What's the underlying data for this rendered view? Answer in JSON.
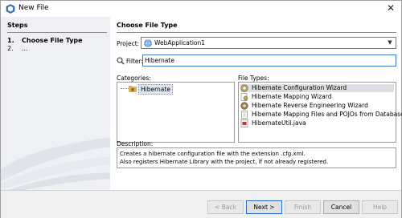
{
  "window": {
    "title": "New File",
    "close_glyph": "✕"
  },
  "steps": {
    "title": "Steps",
    "items": [
      {
        "num": "1.",
        "label": "Choose File Type"
      },
      {
        "num": "2.",
        "label": "..."
      }
    ]
  },
  "main": {
    "title": "Choose File Type",
    "project": {
      "label": "Project:",
      "value": "WebApplication1",
      "icon": "globe-icon"
    },
    "filter": {
      "label": "Filter:",
      "value": "Hibernate",
      "icon": "search-icon"
    },
    "categories": {
      "label": "Categories:",
      "items": [
        {
          "label": "Hibernate",
          "icon": "folder-icon",
          "selected": true
        }
      ]
    },
    "file_types": {
      "label": "File Types:",
      "items": [
        {
          "label": "Hibernate Configuration Wizard",
          "icon": "hibernate-config-icon",
          "selected": true
        },
        {
          "label": "Hibernate Mapping Wizard",
          "icon": "hibernate-mapping-icon",
          "selected": false
        },
        {
          "label": "Hibernate Reverse Engineering Wizard",
          "icon": "hibernate-reveng-icon",
          "selected": false
        },
        {
          "label": "Hibernate Mapping Files and POJOs from Database",
          "icon": "hibernate-pojo-icon",
          "selected": false
        },
        {
          "label": "HibernateUtil.java",
          "icon": "java-file-icon",
          "selected": false
        }
      ]
    },
    "description": {
      "label": "Description:",
      "line1": "Creates a hibernate configuration file with the extension .cfg.xml.",
      "line2": "Also registers Hibernate Library with the project, if not already registered."
    }
  },
  "buttons": {
    "back": "< Back",
    "next": "Next >",
    "finish": "Finish",
    "cancel": "Cancel",
    "help": "Help"
  },
  "colors": {
    "accent": "#3a79c8",
    "selection": "#dfe7f3"
  }
}
